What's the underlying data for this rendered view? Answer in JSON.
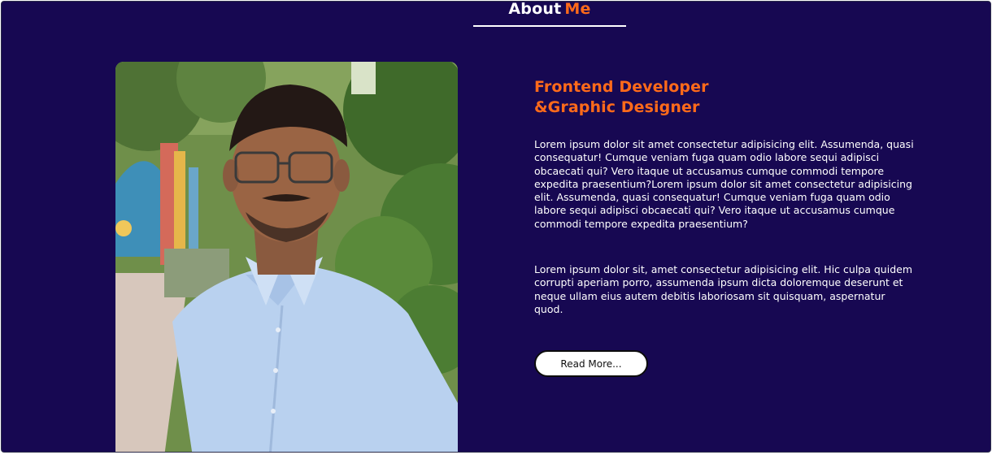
{
  "about": {
    "heading_prefix": "About",
    "heading_accent": "Me"
  },
  "profile": {
    "role": "Frontend Developer\n&Graphic Designer",
    "paragraphs": [
      "Lorem ipsum dolor sit amet consectetur adipisicing elit. Assumenda, quasi consequatur! Cumque veniam fuga quam odio labore sequi adipisci obcaecati qui? Vero itaque ut accusamus cumque commodi tempore expedita praesentium?Lorem ipsum dolor sit amet consectetur adipisicing elit. Assumenda, quasi consequatur! Cumque veniam fuga quam odio labore sequi adipisci obcaecati qui? Vero itaque ut accusamus cumque commodi tempore expedita praesentium?",
      "Lorem ipsum dolor sit, amet consectetur adipisicing elit. Hic culpa quidem corrupti aperiam porro, assumenda ipsum dicta doloremque deserunt et neque ullam eius autem debitis laboriosam sit quisquam, aspernatur quod."
    ],
    "read_more_label": "Read More..."
  },
  "colors": {
    "background": "#170852",
    "accent": "#ff6a1a",
    "text": "#ffffff"
  }
}
